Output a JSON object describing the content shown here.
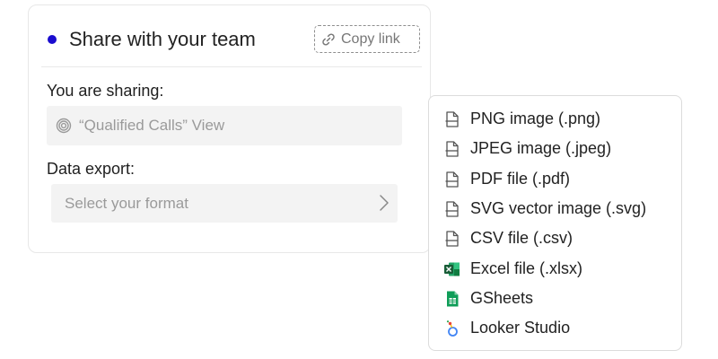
{
  "share": {
    "title": "Share with your team",
    "copy_link_label": "Copy link",
    "sharing_label": "You are sharing:",
    "sharing_value": "“Qualified Calls” View",
    "export_label": "Data export:",
    "export_placeholder": "Select your format",
    "dot_color": "#1a0ccf"
  },
  "export_menu": {
    "items": [
      {
        "label": "PNG image (.png)",
        "icon": "file-icon"
      },
      {
        "label": "JPEG image (.jpeg)",
        "icon": "file-icon"
      },
      {
        "label": "PDF file (.pdf)",
        "icon": "file-icon"
      },
      {
        "label": "SVG vector image (.svg)",
        "icon": "file-icon"
      },
      {
        "label": "CSV file (.csv)",
        "icon": "file-icon"
      },
      {
        "label": "Excel file (.xlsx)",
        "icon": "excel-icon"
      },
      {
        "label": "GSheets",
        "icon": "gsheets-icon"
      },
      {
        "label": "Looker Studio",
        "icon": "looker-studio-icon"
      }
    ]
  }
}
